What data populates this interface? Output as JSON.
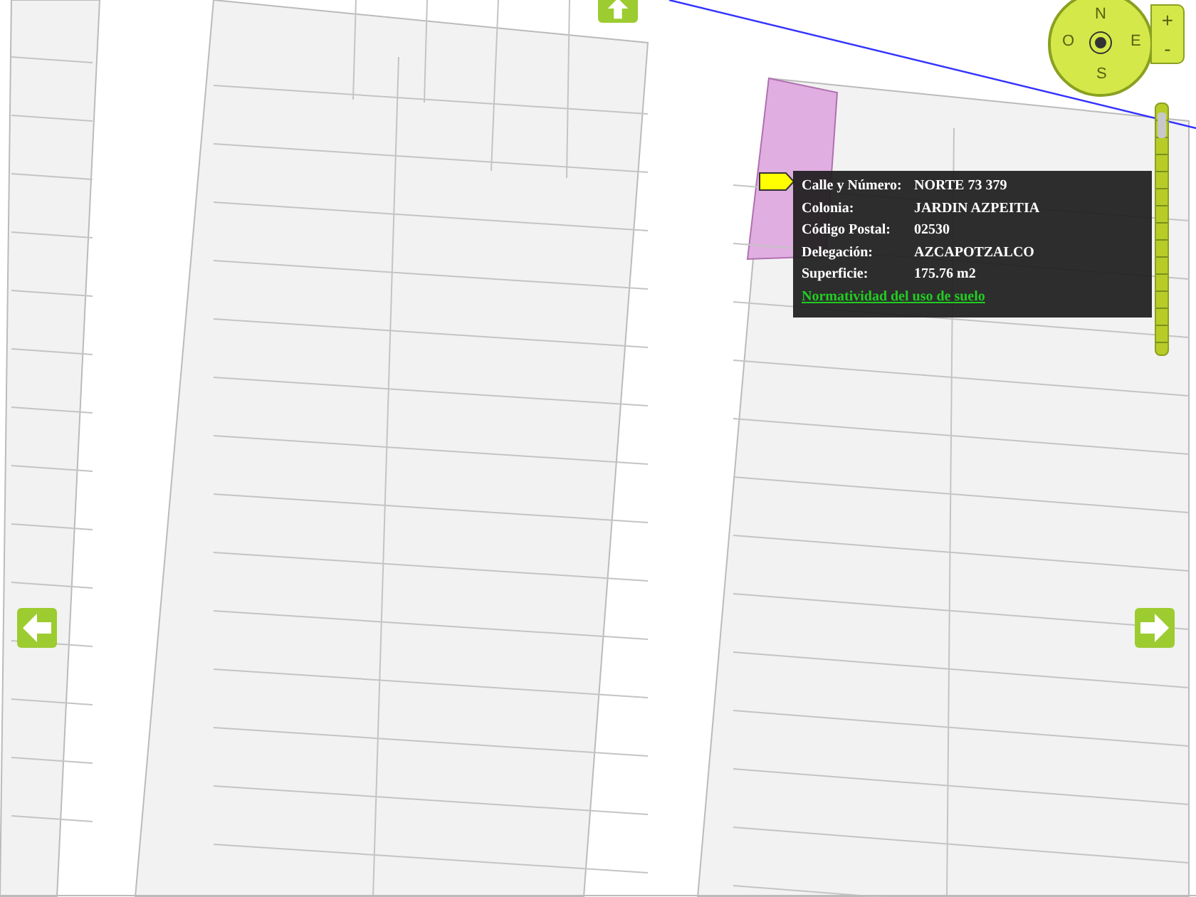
{
  "compass": {
    "north": "N",
    "south": "S",
    "west": "O",
    "east": "E"
  },
  "zoom": {
    "in": "+",
    "out": "-",
    "level": 0.96
  },
  "popup": {
    "rows": [
      {
        "label": "Calle y Número:",
        "value": "NORTE 73 379"
      },
      {
        "label": "Colonia:",
        "value": "JARDIN AZPEITIA"
      },
      {
        "label": "Código Postal:",
        "value": "02530"
      },
      {
        "label": "Delegación:",
        "value": "AZCAPOTZALCO"
      },
      {
        "label": "Superficie:",
        "value": "175.76 m2"
      }
    ],
    "link": "Normatividad del uso de suelo"
  }
}
